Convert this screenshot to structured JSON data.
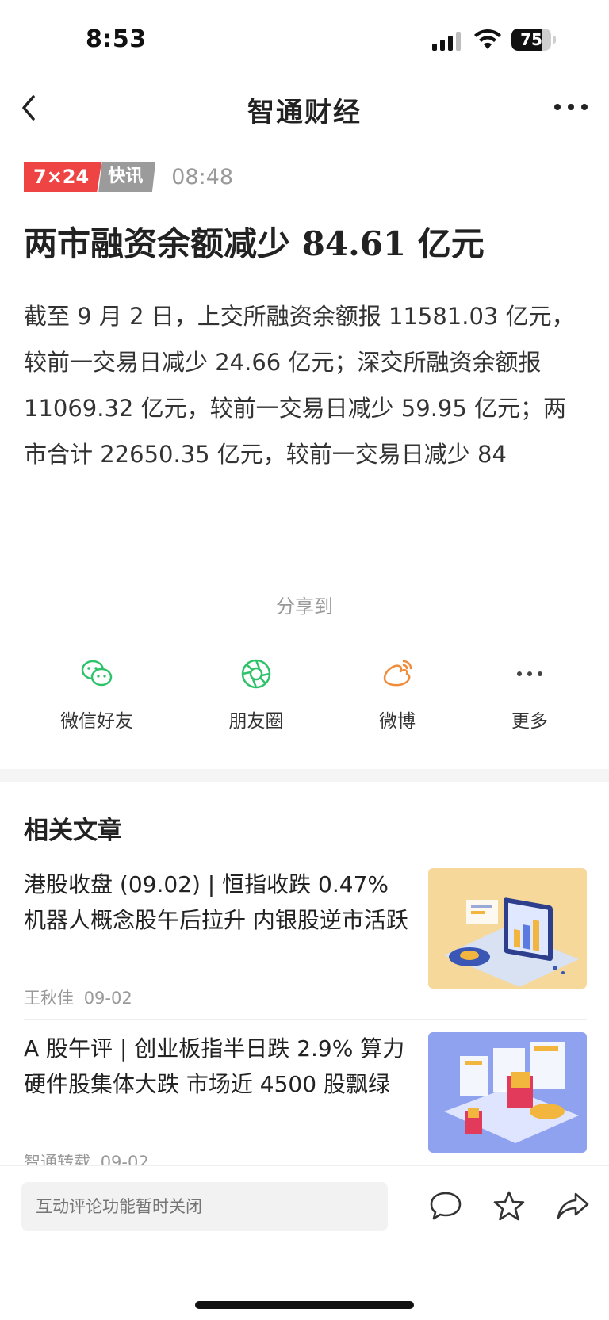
{
  "status_bar": {
    "time": "8:53",
    "battery": "75",
    "battery_level": 0.75
  },
  "nav": {
    "title": "智通财经"
  },
  "article": {
    "tag_primary": "7×24",
    "tag_secondary": "快讯",
    "time": "08:48",
    "headline": "两市融资余额减少 84.61 亿元",
    "body": "截至 9 月 2 日，上交所融资余额报 11581.03 亿元，较前一交易日减少 24.66 亿元；深交所融资余额报 11069.32 亿元，较前一交易日减少 59.95 亿元；两市合计 22650.35 亿元，较前一交易日减少 84"
  },
  "share": {
    "label": "分享到",
    "items": [
      {
        "label": "微信好友",
        "icon": "wechat-icon",
        "color": "#2ec26a"
      },
      {
        "label": "朋友圈",
        "icon": "moments-icon",
        "color": "#2ec26a"
      },
      {
        "label": "微博",
        "icon": "weibo-icon",
        "color": "#f08c3a"
      },
      {
        "label": "更多",
        "icon": "more-icon",
        "color": "#444444"
      }
    ]
  },
  "related": {
    "title": "相关文章",
    "articles": [
      {
        "title": "港股收盘 (09.02) | 恒指收跌 0.47% 机器人概念股午后拉升 内银股逆市活跃",
        "author": "王秋佳",
        "date": "09-02"
      },
      {
        "title": "A 股午评 | 创业板指半日跌 2.9% 算力硬件股集体大跌 市场近 4500 股飘绿",
        "author": "智通转载",
        "date": "09-02"
      }
    ]
  },
  "bottom_bar": {
    "comment_placeholder": "互动评论功能暂时关闭"
  },
  "colors": {
    "accent_red": "#ef4444",
    "tag_grey": "#9b9b9b"
  }
}
